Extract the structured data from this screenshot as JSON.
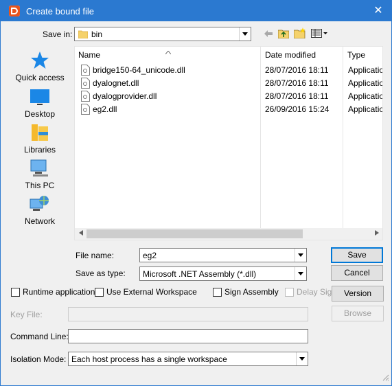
{
  "window": {
    "title": "Create bound file",
    "close_glyph": "✕"
  },
  "save_in": {
    "label": "Save in:",
    "value": "bin"
  },
  "places": [
    {
      "label": "Quick access",
      "icon": "star-icon"
    },
    {
      "label": "Desktop",
      "icon": "desktop-icon"
    },
    {
      "label": "Libraries",
      "icon": "libraries-icon"
    },
    {
      "label": "This PC",
      "icon": "computer-icon"
    },
    {
      "label": "Network",
      "icon": "network-icon"
    }
  ],
  "file_list": {
    "columns": {
      "name": "Name",
      "date": "Date modified",
      "type": "Type"
    },
    "rows": [
      {
        "name": "bridge150-64_unicode.dll",
        "date": "28/07/2016 18:11",
        "type": "Applicatio"
      },
      {
        "name": "dyalognet.dll",
        "date": "28/07/2016 18:11",
        "type": "Applicatio"
      },
      {
        "name": "dyalogprovider.dll",
        "date": "28/07/2016 18:11",
        "type": "Applicatio"
      },
      {
        "name": "eg2.dll",
        "date": "26/09/2016 15:24",
        "type": "Applicatio"
      }
    ]
  },
  "file_name": {
    "label": "File name:",
    "value": "eg2"
  },
  "save_as_type": {
    "label": "Save as type:",
    "value": "Microsoft .NET Assembly (*.dll)"
  },
  "buttons": {
    "save": "Save",
    "cancel": "Cancel",
    "version": "Version",
    "browse": "Browse"
  },
  "options": {
    "runtime": "Runtime application",
    "external_ws": "Use External Workspace",
    "sign_assembly": "Sign Assembly",
    "delay_sign": "Delay Sign"
  },
  "key_file": {
    "label": "Key File:",
    "value": ""
  },
  "command_line": {
    "label": "Command Line:",
    "value": ""
  },
  "isolation": {
    "label": "Isolation Mode:",
    "value": "Each host process has a single workspace"
  },
  "colors": {
    "titlebar": "#2b79d0",
    "accent": "#0078d7",
    "background": "#f0f0f0"
  }
}
